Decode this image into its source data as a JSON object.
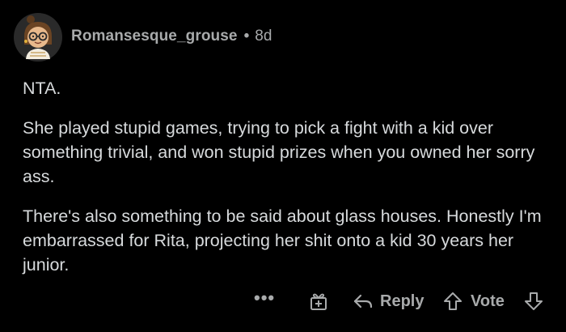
{
  "comment": {
    "author": "Romansesque_grouse",
    "separator": "•",
    "age": "8d",
    "paragraphs": [
      "NTA.",
      "She played stupid games, trying to pick a fight with a kid over something trivial, and won stupid prizes when you owned her sorry ass.",
      "There's also something to be said about glass houses. Honestly I'm embarrassed for Rita, projecting her shit onto a kid 30 years her junior."
    ]
  },
  "actions": {
    "more_label": "•••",
    "reply_label": "Reply",
    "vote_label": "Vote"
  },
  "icons": {
    "avatar": "avatar",
    "more": "more-icon",
    "award": "award-icon",
    "reply": "reply-arrow-icon",
    "upvote": "upvote-icon",
    "downvote": "downvote-icon"
  },
  "colors": {
    "background": "#000000",
    "text": "#d7dadc",
    "meta": "#a8aaab"
  }
}
